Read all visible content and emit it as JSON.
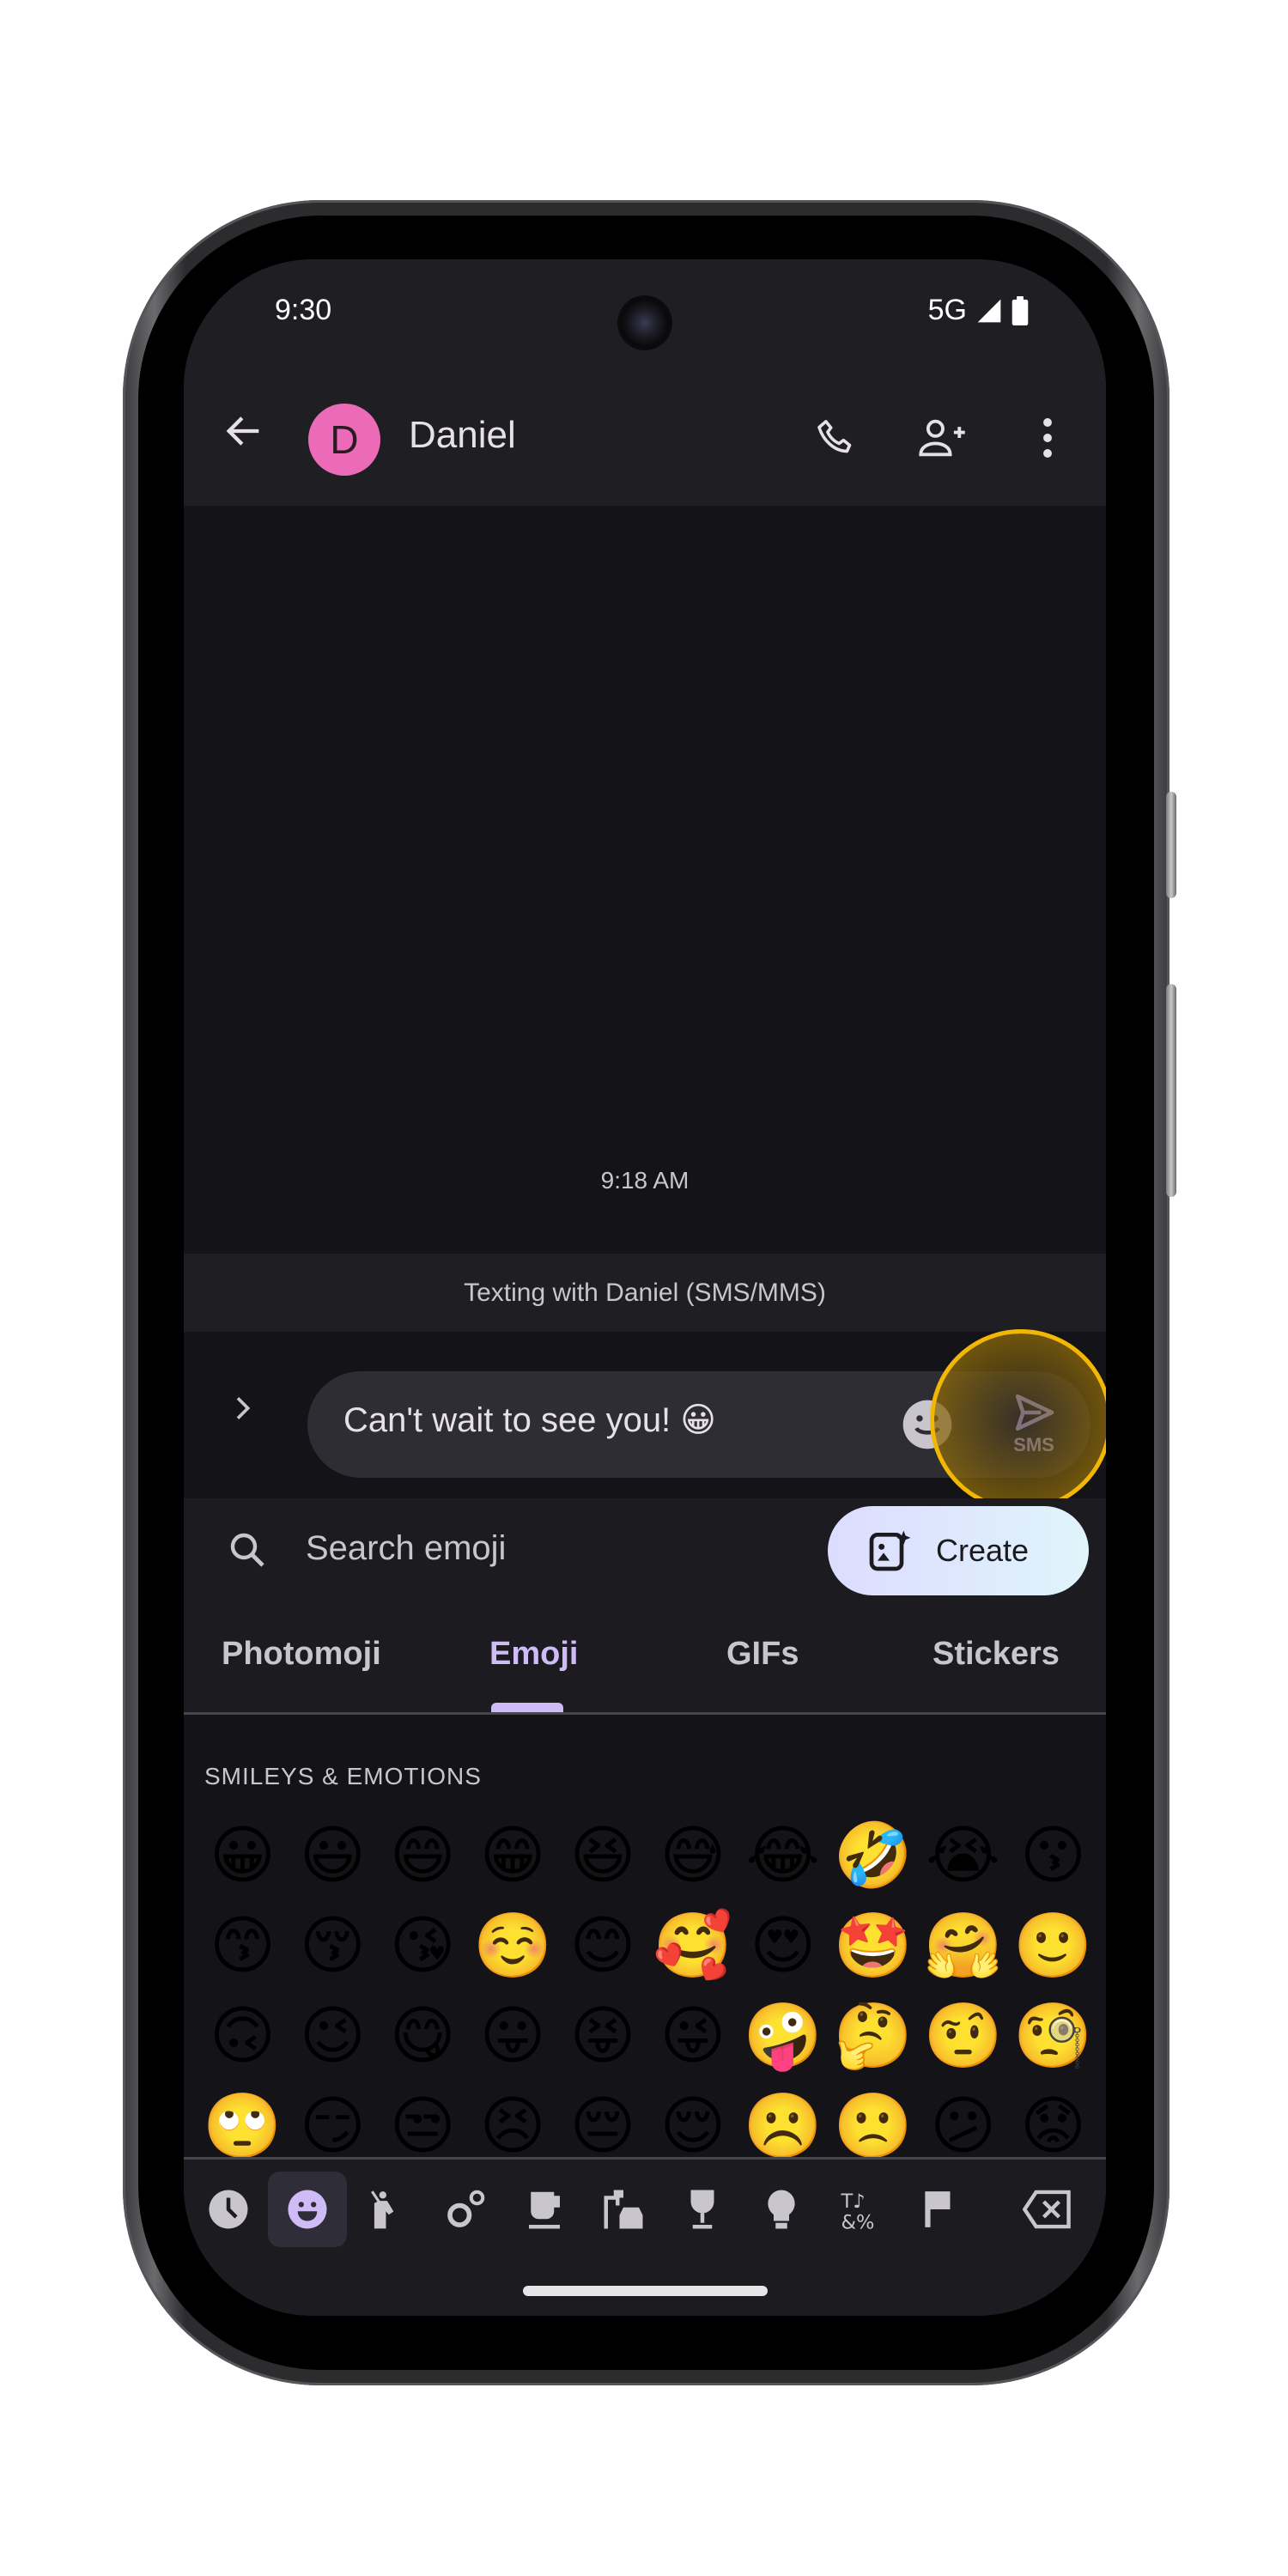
{
  "status_bar": {
    "time": "9:30",
    "network": "5G",
    "icons": [
      "signal-icon",
      "battery-icon"
    ]
  },
  "header": {
    "back_icon": "arrow-back-icon",
    "avatar_letter": "D",
    "contact_name": "Daniel",
    "avatar_color": "#ec6bb8",
    "actions": [
      "phone-icon",
      "add-person-icon",
      "more-vert-icon"
    ]
  },
  "conversation": {
    "timestamp": "9:18 AM"
  },
  "banner": {
    "text": "Texting with Daniel (SMS/MMS)"
  },
  "compose": {
    "expand_icon": "chevron-right-icon",
    "message": "Can't wait to see you! 😀",
    "emoji_icon": "emoji-icon",
    "send_label": "SMS",
    "send_icon": "send-icon",
    "highlight_color": "#f2b705"
  },
  "emoji_search": {
    "placeholder": "Search emoji",
    "create_label": "Create"
  },
  "tabs": [
    {
      "label": "Photomoji",
      "active": false
    },
    {
      "label": "Emoji",
      "active": true
    },
    {
      "label": "GIFs",
      "active": false
    },
    {
      "label": "Stickers",
      "active": false
    }
  ],
  "emoji_section": {
    "title": "SMILEYS & EMOTIONS",
    "emojis": [
      "😀",
      "😃",
      "😄",
      "😁",
      "😆",
      "😅",
      "😂",
      "🤣",
      "😭",
      "😗",
      "😙",
      "😚",
      "😘",
      "☺️",
      "😊",
      "🥰",
      "😍",
      "🤩",
      "🤗",
      "🙂",
      "🙃",
      "😉",
      "😋",
      "😛",
      "😝",
      "😜",
      "🤪",
      "🤔",
      "🤨",
      "🧐",
      "🙄",
      "😏",
      "😒",
      "😣",
      "😔",
      "😌",
      "☹️",
      "🙁",
      "😕",
      "😟"
    ]
  },
  "categories": [
    {
      "name": "recent-icon",
      "active": false
    },
    {
      "name": "smileys-icon",
      "active": true
    },
    {
      "name": "people-icon",
      "active": false
    },
    {
      "name": "nature-icon",
      "active": false
    },
    {
      "name": "food-icon",
      "active": false
    },
    {
      "name": "travel-icon",
      "active": false
    },
    {
      "name": "activities-icon",
      "active": false
    },
    {
      "name": "objects-icon",
      "active": false
    },
    {
      "name": "symbols-icon",
      "active": false
    },
    {
      "name": "flags-icon",
      "active": false
    },
    {
      "name": "backspace-icon",
      "active": false
    }
  ],
  "colors": {
    "accent": "#cfbcf7",
    "background": "#141317",
    "surface": "#1f1e23"
  }
}
